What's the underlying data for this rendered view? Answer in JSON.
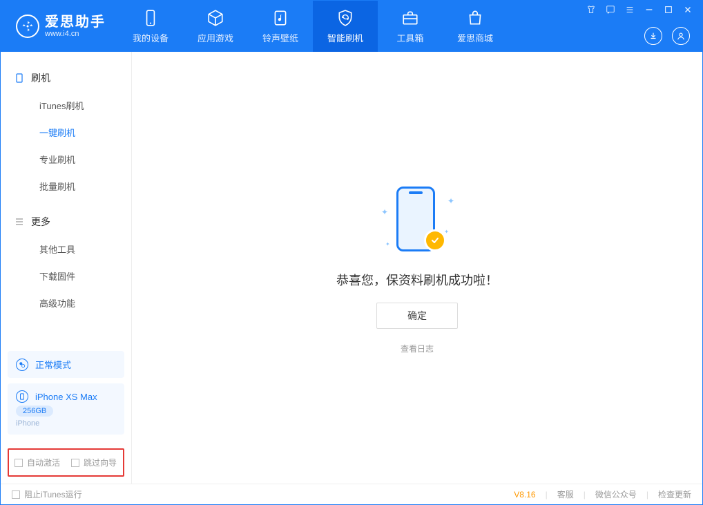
{
  "app": {
    "name_cn": "爱思助手",
    "name_en": "www.i4.cn"
  },
  "tabs": [
    {
      "label": "我的设备"
    },
    {
      "label": "应用游戏"
    },
    {
      "label": "铃声壁纸"
    },
    {
      "label": "智能刷机"
    },
    {
      "label": "工具箱"
    },
    {
      "label": "爱思商城"
    }
  ],
  "sidebar": {
    "section1": {
      "title": "刷机",
      "items": [
        "iTunes刷机",
        "一键刷机",
        "专业刷机",
        "批量刷机"
      ]
    },
    "section2": {
      "title": "更多",
      "items": [
        "其他工具",
        "下载固件",
        "高级功能"
      ]
    }
  },
  "device": {
    "mode_label": "正常模式",
    "name": "iPhone XS Max",
    "storage": "256GB",
    "type": "iPhone"
  },
  "options": {
    "auto_activate": "自动激活",
    "skip_guide": "跳过向导"
  },
  "main": {
    "success_message": "恭喜您，保资料刷机成功啦！",
    "ok_button": "确定",
    "view_log": "查看日志"
  },
  "footer": {
    "block_itunes": "阻止iTunes运行",
    "version": "V8.16",
    "links": [
      "客服",
      "微信公众号",
      "检查更新"
    ]
  }
}
